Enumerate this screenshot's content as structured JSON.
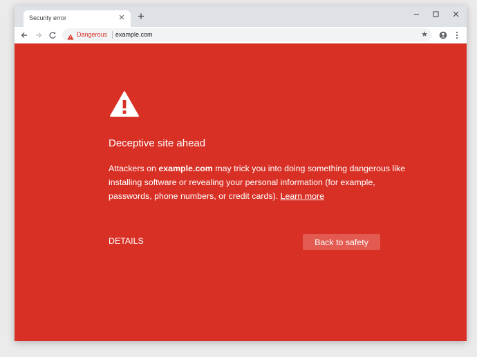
{
  "browser": {
    "tab": {
      "title": "Security error"
    },
    "new_tab_symbol": "+",
    "close_symbol": "✕",
    "window_controls": [
      "minimize-icon",
      "maximize-icon",
      "close-icon"
    ],
    "omnibox": {
      "security_label": "Dangerous",
      "url": "example.com"
    },
    "star_symbol": "★"
  },
  "interstitial": {
    "heading": "Deceptive site ahead",
    "body_prefix": "Attackers on ",
    "body_domain": "example.com",
    "body_suffix": " may trick you into doing something dangerous like installing software or revealing your personal information (for example, passwords, phone numbers, or credit cards). ",
    "learn_more": "Learn more",
    "details_label": "DETAILS",
    "back_label": "Back to safety"
  },
  "colors": {
    "danger_red": "#d93025",
    "button_light": "#e25a50",
    "tabstrip": "#dee1e6"
  }
}
